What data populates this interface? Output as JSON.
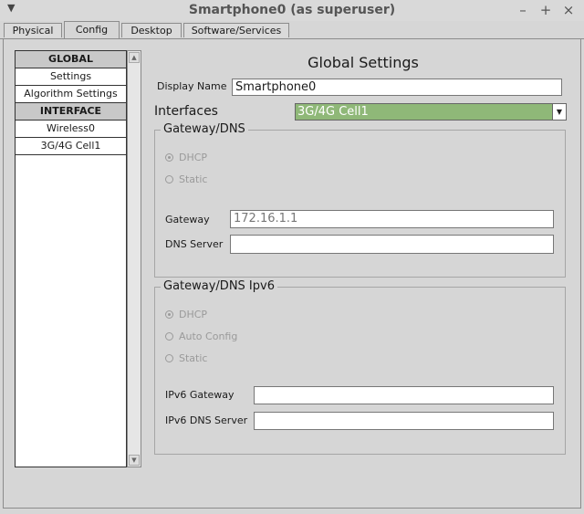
{
  "window": {
    "title": "Smartphone0 (as superuser)",
    "menu_glyph": "▼",
    "buttons": {
      "minimize": "–",
      "maximize": "+",
      "close": "×"
    }
  },
  "tabs": [
    {
      "label": "Physical"
    },
    {
      "label": "Config"
    },
    {
      "label": "Desktop"
    },
    {
      "label": "Software/Services"
    }
  ],
  "sidebar": {
    "items": [
      {
        "label": "GLOBAL"
      },
      {
        "label": "Settings"
      },
      {
        "label": "Algorithm Settings"
      },
      {
        "label": "INTERFACE"
      },
      {
        "label": "Wireless0"
      },
      {
        "label": "3G/4G Cell1"
      }
    ],
    "scroll_up": "▲",
    "scroll_down": "▼"
  },
  "global_settings": {
    "title": "Global Settings",
    "display_name_label": "Display Name",
    "display_name_value": "Smartphone0",
    "interfaces_label": "Interfaces",
    "interfaces_value": "3G/4G Cell1",
    "combo_arrow": "▼"
  },
  "gateway_dns": {
    "title": "Gateway/DNS",
    "dhcp_label": "DHCP",
    "static_label": "Static",
    "gateway_label": "Gateway",
    "gateway_value": "172.16.1.1",
    "dns_label": "DNS Server",
    "dns_value": ""
  },
  "gateway_dns_v6": {
    "title": "Gateway/DNS Ipv6",
    "dhcp_label": "DHCP",
    "auto_label": "Auto Config",
    "static_label": "Static",
    "gateway_label": "IPv6 Gateway",
    "gateway_value": "",
    "dns_label": "IPv6 DNS Server",
    "dns_value": ""
  },
  "colors": {
    "window_bg": "#d6d6d6",
    "combo_selected": "#8fb878"
  }
}
